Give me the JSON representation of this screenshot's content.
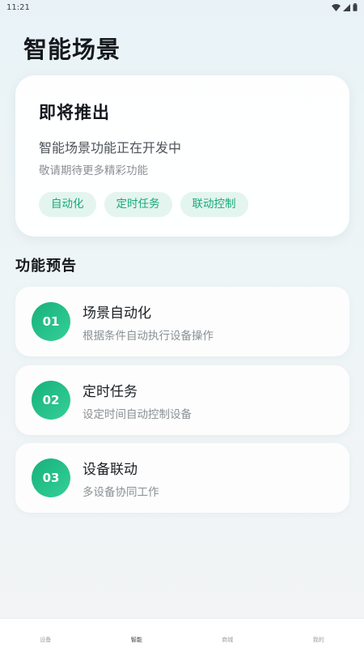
{
  "status_bar": {
    "time": "11:21",
    "icons": [
      "wifi-icon",
      "signal-icon",
      "battery-icon"
    ]
  },
  "page": {
    "title": "智能场景"
  },
  "hero": {
    "title": "即将推出",
    "subtitle": "智能场景功能正在开发中",
    "note": "敬请期待更多精彩功能",
    "tags": [
      "自动化",
      "定时任务",
      "联动控制"
    ]
  },
  "section": {
    "title": "功能预告"
  },
  "features": [
    {
      "number": "01",
      "title": "场景自动化",
      "description": "根据条件自动执行设备操作"
    },
    {
      "number": "02",
      "title": "定时任务",
      "description": "设定时间自动控制设备"
    },
    {
      "number": "03",
      "title": "设备联动",
      "description": "多设备协同工作"
    }
  ],
  "bottom_nav": {
    "items": [
      {
        "label": "设备",
        "active": false
      },
      {
        "label": "智能",
        "active": true
      },
      {
        "label": "商城",
        "active": false
      },
      {
        "label": "我的",
        "active": false
      }
    ]
  },
  "colors": {
    "accent": "#19a978",
    "tag_bg": "#e3f5ee",
    "badge_gradient_start": "#17b07b",
    "badge_gradient_end": "#35d097"
  }
}
